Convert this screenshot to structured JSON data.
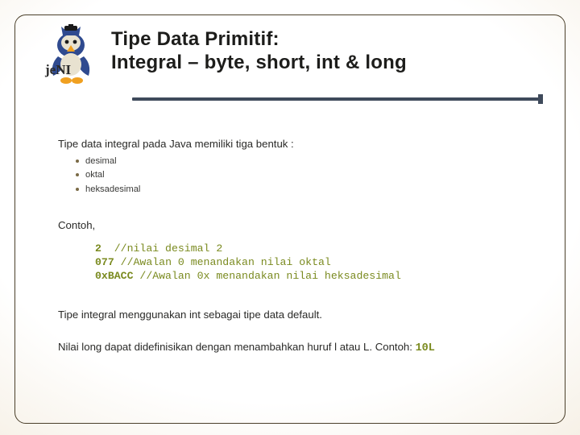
{
  "title_line1": "Tipe Data Primitif:",
  "title_line2": "Integral – byte, short, int & long",
  "logo_text": "jeNI",
  "lead": "Tipe data integral pada Java memiliki tiga bentuk :",
  "bullets": [
    "desimal",
    "oktal",
    "heksadesimal"
  ],
  "contoh_label": "Contoh,",
  "code": {
    "l1_val": "2",
    "l1_cm": "//nilai desimal 2",
    "l2_val": "077",
    "l2_cm": "//Awalan 0 menandakan nilai oktal",
    "l3_val": "0xBACC",
    "l3_cm": "//Awalan 0x menandakan nilai heksadesimal"
  },
  "para1": "Tipe integral menggunakan int sebagai tipe data default.",
  "para2_a": "Nilai long dapat didefinisikan dengan menambahkan huruf ",
  "para2_l": "l",
  "para2_b": " atau ",
  "para2_L": "L",
  "para2_c": ". Contoh: ",
  "para2_code": "10L"
}
